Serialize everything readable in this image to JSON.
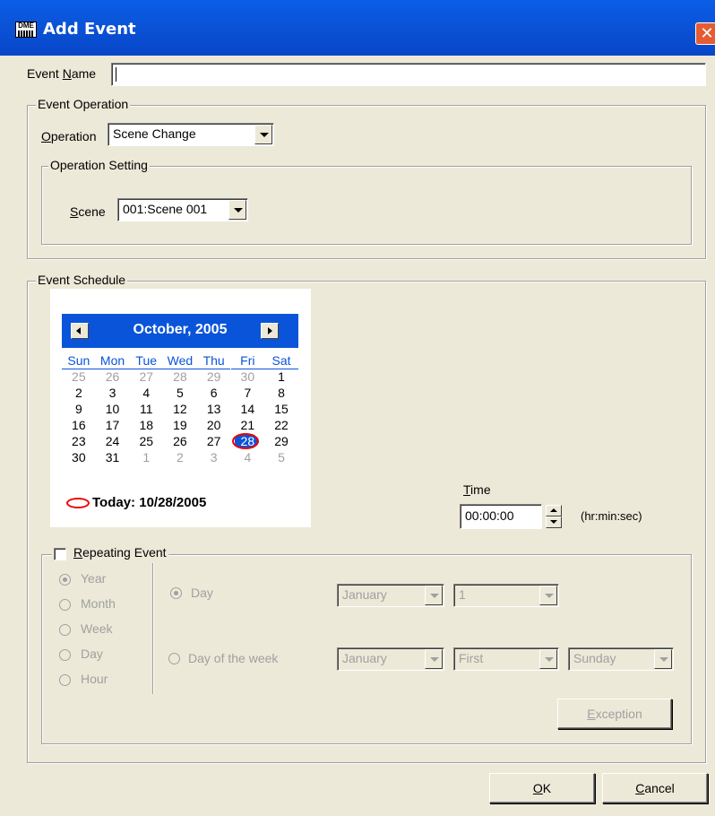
{
  "window": {
    "title": "Add Event",
    "logo_text": "DME"
  },
  "event_name": {
    "label_pre": "Event ",
    "label_key": "N",
    "label_post": "ame",
    "value": ""
  },
  "event_operation": {
    "group_label": "Event Operation",
    "operation_label_key": "O",
    "operation_label_post": "peration",
    "operation_value": "Scene Change",
    "setting": {
      "group_label": "Operation Setting",
      "scene_label_key": "S",
      "scene_label_post": "cene",
      "scene_value": "001:Scene 001"
    }
  },
  "schedule": {
    "group_label": "Event Schedule",
    "calendar": {
      "month_title": "October, 2005",
      "dow": [
        "Sun",
        "Mon",
        "Tue",
        "Wed",
        "Thu",
        "Fri",
        "Sat"
      ],
      "weeks": [
        [
          "25",
          "26",
          "27",
          "28",
          "29",
          "30",
          "1"
        ],
        [
          "2",
          "3",
          "4",
          "5",
          "6",
          "7",
          "8"
        ],
        [
          "9",
          "10",
          "11",
          "12",
          "13",
          "14",
          "15"
        ],
        [
          "16",
          "17",
          "18",
          "19",
          "20",
          "21",
          "22"
        ],
        [
          "23",
          "24",
          "25",
          "26",
          "27",
          "28",
          "29"
        ],
        [
          "30",
          "31",
          "1",
          "2",
          "3",
          "4",
          "5"
        ]
      ],
      "selected_date": "28",
      "today_label": "Today: 10/28/2005"
    },
    "time": {
      "label_key": "T",
      "label_post": "ime",
      "value": "00:00:00",
      "unit": "(hr:min:sec)"
    },
    "repeating": {
      "checkbox_key": "R",
      "checkbox_post": "epeating Event",
      "checked": false,
      "periods": [
        "Year",
        "Month",
        "Week",
        "Day",
        "Hour"
      ],
      "selected_period": "Year",
      "day_option": {
        "label": "Day",
        "month": "January",
        "day": "1"
      },
      "dow_option": {
        "label": "Day of the week",
        "month": "January",
        "week": "First",
        "weekday": "Sunday"
      },
      "exception_key": "E",
      "exception_post": "xception"
    }
  },
  "buttons": {
    "ok_key": "O",
    "ok_post": "K",
    "cancel_key": "C",
    "cancel_post": "ancel"
  },
  "colors": {
    "titlebar": "#0a54d9",
    "calendar_accent": "#0a54d9",
    "close": "#e45b34",
    "face": "#ece9d8",
    "today_ring": "#e00000"
  }
}
